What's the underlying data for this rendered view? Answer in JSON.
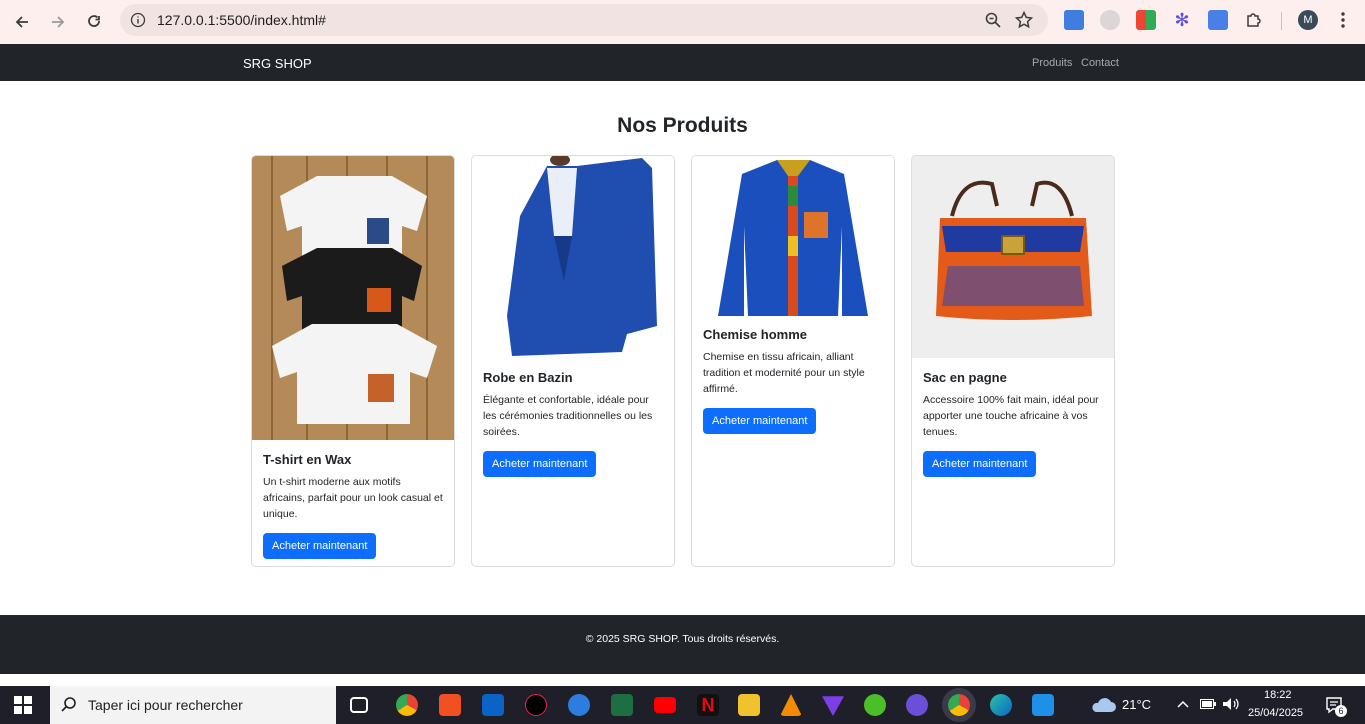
{
  "browser": {
    "url": "127.0.0.1:5500/index.html#",
    "profile_initial": "M"
  },
  "site": {
    "brand": "SRG SHOP",
    "nav": [
      "Produits",
      "Contact"
    ],
    "heading": "Nos Produits",
    "products": [
      {
        "title": "T-shirt en Wax",
        "description": "Un t-shirt moderne aux motifs africains, parfait pour un look casual et unique.",
        "button": "Acheter maintenant",
        "image_icon": "tshirts-photo"
      },
      {
        "title": "Robe en Bazin",
        "description": "Élégante et confortable, idéale pour les cérémonies traditionnelles ou les soirées.",
        "button": "Acheter maintenant",
        "image_icon": "dress-photo"
      },
      {
        "title": "Chemise homme",
        "description": "Chemise en tissu africain, alliant tradition et modernité pour un style affirmé.",
        "button": "Acheter maintenant",
        "image_icon": "shirt-photo"
      },
      {
        "title": "Sac en pagne",
        "description": "Accessoire 100% fait main, idéal pour apporter une touche africaine à vos tenues.",
        "button": "Acheter maintenant",
        "image_icon": "bag-photo"
      }
    ],
    "footer": "© 2025 SRG SHOP. Tous droits réservés."
  },
  "taskbar": {
    "search_placeholder": "Taper ici pour rechercher",
    "weather": "21°C",
    "time": "18:22",
    "date": "25/04/2025",
    "notifications": "6"
  },
  "colors": {
    "navbar": "#212529",
    "primary": "#0d6efd",
    "chrome": "#fcefee"
  }
}
